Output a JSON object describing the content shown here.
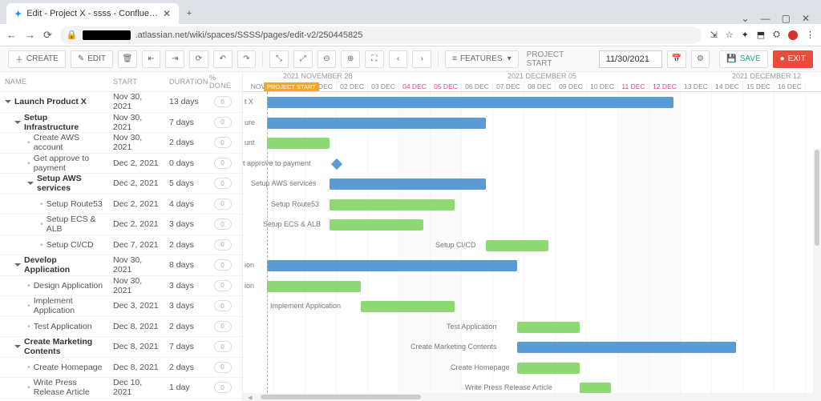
{
  "browser": {
    "tab_title": "Edit - Project X - ssss - Conflue…",
    "new_tab_icon": "+",
    "win": {
      "chevron": "⌄",
      "min": "—",
      "square": "▢",
      "close": "✕"
    },
    "nav": {
      "back": "←",
      "fwd": "→",
      "reload": "⟳"
    },
    "addr_host": ".atlassian.net/wiki/spaces/SSSS/pages/edit-v2/250445825",
    "right_icons": [
      "⇲",
      "☆",
      "✦",
      "⬒",
      "⛭",
      "⋮"
    ]
  },
  "toolbar": {
    "create": "CREATE",
    "edit": "EDIT",
    "features": "FEATURES",
    "proj_start_lbl": "PROJECT START",
    "date_value": "11/30/2021",
    "save": "SAVE",
    "exit": "EXIT",
    "icons": {
      "plus": "＋",
      "pencil": "✎",
      "trash": "🗑",
      "outdent": "⇤",
      "indent": "⇥",
      "refresh": "⟳",
      "undo": "↶",
      "redo": "↷",
      "collapse": "⤡",
      "expand": "⤢",
      "zoom_out": "⊖",
      "zoom_in": "⊕",
      "fit": "⛶",
      "prev": "‹",
      "next": "›",
      "list": "≡",
      "cal": "📅",
      "gear": "⚙",
      "bullet": "●"
    }
  },
  "grid": {
    "cols": {
      "name": "NAME",
      "start": "START",
      "duration": "DURATION",
      "done": "% DONE"
    },
    "done_default": "0"
  },
  "tasks": [
    {
      "name": "Launch Product X",
      "start": "Nov 30, 2021",
      "dur": "13 days",
      "bold": true,
      "indent": 0,
      "caret": true
    },
    {
      "name": "Setup Infrastructure",
      "start": "Nov 30, 2021",
      "dur": "7 days",
      "bold": true,
      "indent": 1,
      "caret": true
    },
    {
      "name": "Create AWS account",
      "start": "Nov 30, 2021",
      "dur": "2 days",
      "bold": false,
      "indent": 2,
      "dot": true
    },
    {
      "name": "Get approve to payment",
      "start": "Dec 2, 2021",
      "dur": "0 days",
      "bold": false,
      "indent": 2,
      "dot": true
    },
    {
      "name": "Setup AWS services",
      "start": "Dec 2, 2021",
      "dur": "5 days",
      "bold": true,
      "indent": 2,
      "caret": true
    },
    {
      "name": "Setup Route53",
      "start": "Dec 2, 2021",
      "dur": "4 days",
      "bold": false,
      "indent": 3,
      "dot": true
    },
    {
      "name": "Setup ECS & ALB",
      "start": "Dec 2, 2021",
      "dur": "3 days",
      "bold": false,
      "indent": 3,
      "dot": true
    },
    {
      "name": "Setup CI/CD",
      "start": "Dec 7, 2021",
      "dur": "2 days",
      "bold": false,
      "indent": 3,
      "dot": true
    },
    {
      "name": "Develop Application",
      "start": "Nov 30, 2021",
      "dur": "8 days",
      "bold": true,
      "indent": 1,
      "caret": true
    },
    {
      "name": "Design Application",
      "start": "Nov 30, 2021",
      "dur": "3 days",
      "bold": false,
      "indent": 2,
      "dot": true
    },
    {
      "name": "Implement Application",
      "start": "Dec 3, 2021",
      "dur": "3 days",
      "bold": false,
      "indent": 2,
      "dot": true
    },
    {
      "name": "Test Application",
      "start": "Dec 8, 2021",
      "dur": "2 days",
      "bold": false,
      "indent": 2,
      "dot": true
    },
    {
      "name": "Create Marketing Contents",
      "start": "Dec 8, 2021",
      "dur": "7 days",
      "bold": true,
      "indent": 1,
      "caret": true
    },
    {
      "name": "Create Homepage",
      "start": "Dec 8, 2021",
      "dur": "2 days",
      "bold": false,
      "indent": 2,
      "dot": true
    },
    {
      "name": "Write Press Release Article",
      "start": "Dec 10, 2021",
      "dur": "1 day",
      "bold": false,
      "indent": 2,
      "dot": true
    }
  ],
  "timeline": {
    "months": [
      {
        "label": "2021 NOVEMBER 28"
      },
      {
        "label": "2021 DECEMBER 05"
      },
      {
        "label": "2021 DECEMBER 12"
      }
    ],
    "proj_start_label": "PROJECT START",
    "days": [
      {
        "l": "NOV",
        "we": false
      },
      {
        "l": "",
        "we": false
      },
      {
        "l": "01 DEC",
        "we": false
      },
      {
        "l": "02 DEC",
        "we": false
      },
      {
        "l": "03 DEC",
        "we": false
      },
      {
        "l": "04 DEC",
        "we": true
      },
      {
        "l": "05 DEC",
        "we": true
      },
      {
        "l": "06 DEC",
        "we": false
      },
      {
        "l": "07 DEC",
        "we": false
      },
      {
        "l": "08 DEC",
        "we": false
      },
      {
        "l": "09 DEC",
        "we": false
      },
      {
        "l": "10 DEC",
        "we": false
      },
      {
        "l": "11 DEC",
        "we": true
      },
      {
        "l": "12 DEC",
        "we": true
      },
      {
        "l": "13 DEC",
        "we": false
      },
      {
        "l": "14 DEC",
        "we": false
      },
      {
        "l": "15 DEC",
        "we": false
      },
      {
        "l": "16 DEC",
        "we": false
      }
    ]
  },
  "gantt": {
    "labels": {
      "t0": "t X",
      "t1": "ure",
      "t2": "unt",
      "t3": "Get approve to payment",
      "t4": "Setup AWS services",
      "t5": "Setup Route53",
      "t6": "Setup ECS & ALB",
      "t7": "Setup CI/CD",
      "t8": "ion",
      "t9": "ion",
      "t10": "Implement Application",
      "t11": "Test Application",
      "t12": "Create Marketing Contents",
      "t13": "Create Homepage",
      "t14": "Write Press Release Article"
    }
  },
  "chart_data": {
    "type": "gantt",
    "start_date": "2021-11-30",
    "date_range": [
      "2021-11-28",
      "2021-12-16"
    ],
    "items": [
      {
        "name": "Launch Product X",
        "start": "2021-11-30",
        "days": 13,
        "group": true
      },
      {
        "name": "Setup Infrastructure",
        "start": "2021-11-30",
        "days": 7,
        "group": true
      },
      {
        "name": "Create AWS account",
        "start": "2021-11-30",
        "days": 2
      },
      {
        "name": "Get approve to payment",
        "start": "2021-12-02",
        "days": 0,
        "milestone": true
      },
      {
        "name": "Setup AWS services",
        "start": "2021-12-02",
        "days": 5,
        "group": true
      },
      {
        "name": "Setup Route53",
        "start": "2021-12-02",
        "days": 4
      },
      {
        "name": "Setup ECS & ALB",
        "start": "2021-12-02",
        "days": 3
      },
      {
        "name": "Setup CI/CD",
        "start": "2021-12-07",
        "days": 2
      },
      {
        "name": "Develop Application",
        "start": "2021-11-30",
        "days": 8,
        "group": true
      },
      {
        "name": "Design Application",
        "start": "2021-11-30",
        "days": 3
      },
      {
        "name": "Implement Application",
        "start": "2021-12-03",
        "days": 3
      },
      {
        "name": "Test Application",
        "start": "2021-12-08",
        "days": 2
      },
      {
        "name": "Create Marketing Contents",
        "start": "2021-12-08",
        "days": 7,
        "group": true
      },
      {
        "name": "Create Homepage",
        "start": "2021-12-08",
        "days": 2
      },
      {
        "name": "Write Press Release Article",
        "start": "2021-12-10",
        "days": 1
      }
    ]
  }
}
